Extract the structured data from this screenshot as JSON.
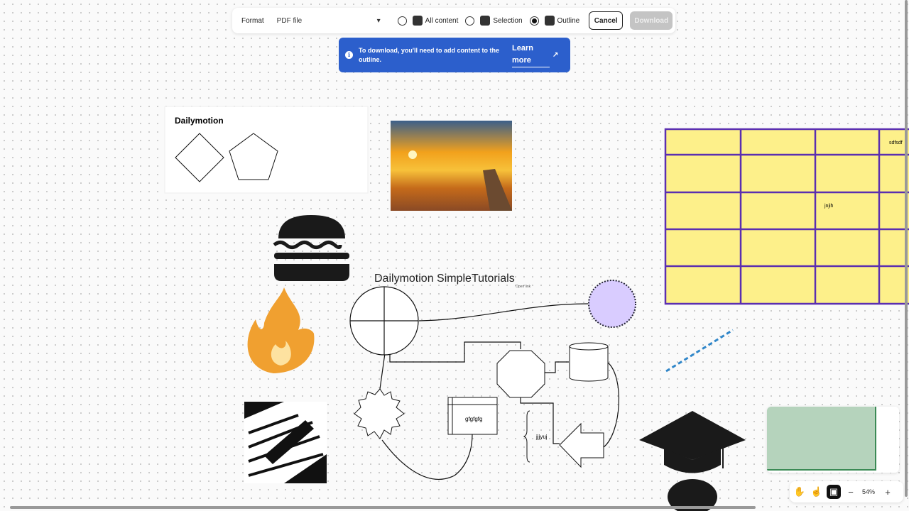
{
  "toolbar": {
    "format_label": "Format",
    "format_value": "PDF file",
    "options": [
      "All content",
      "Selection",
      "Outline"
    ],
    "selected": "Outline",
    "cancel": "Cancel",
    "download": "Download"
  },
  "banner": {
    "text": "To download, you'll need to add content to the outline.",
    "link": "Learn more"
  },
  "canvas": {
    "frame_title": "Dailymotion",
    "heading": "Dailymotion SimpleTutorials",
    "open_link": "Open link",
    "box_text": "gfgfgfg",
    "brace_text": "jjjyuj",
    "table_cells": {
      "top_right": "sdfsdf",
      "middle": "jnjih"
    },
    "table_fill": "#fdf08a",
    "table_border": "#5b2fb0",
    "circle_fill": "#d9ccff"
  },
  "zoom": {
    "level": "54%"
  }
}
